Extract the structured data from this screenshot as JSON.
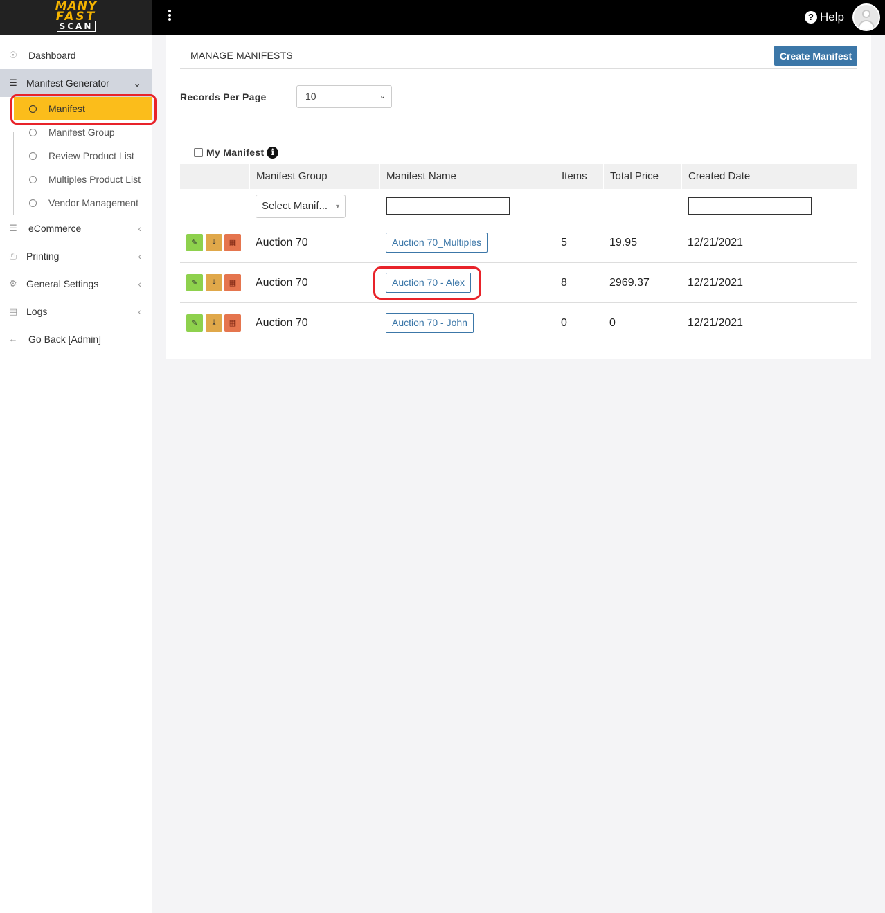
{
  "app": {
    "logo": {
      "line1": "MANY",
      "line2": "FAST",
      "line3": "SCAN"
    },
    "help_label": "Help"
  },
  "sidebar": {
    "items": [
      {
        "label": "Dashboard",
        "icon": "compass-icon"
      },
      {
        "label": "Manifest Generator",
        "icon": "list-icon",
        "expanded": true
      },
      {
        "label": "eCommerce",
        "icon": "list-icon"
      },
      {
        "label": "Printing",
        "icon": "printer-icon"
      },
      {
        "label": "General Settings",
        "icon": "gears-icon"
      },
      {
        "label": "Logs",
        "icon": "archive-icon"
      },
      {
        "label": "Go Back [Admin]",
        "icon": "arrow-left-icon"
      }
    ],
    "sub_items": [
      {
        "label": "Manifest",
        "active": true
      },
      {
        "label": "Manifest Group"
      },
      {
        "label": "Review Product List"
      },
      {
        "label": "Multiples Product List"
      },
      {
        "label": "Vendor Management"
      }
    ]
  },
  "main": {
    "title": "MANAGE MANIFESTS",
    "create_button": "Create Manifest",
    "records_per_page_label": "Records Per Page",
    "records_per_page_value": "10",
    "my_manifest_label": "My Manifest",
    "table": {
      "columns": [
        "Manifest Group",
        "Manifest Name",
        "Items",
        "Total Price",
        "Created Date"
      ],
      "group_filter_placeholder": "Select Manif...",
      "rows": [
        {
          "group": "Auction 70",
          "name": "Auction 70_Multiples",
          "items": "5",
          "total_price": "19.95",
          "created": "12/21/2021"
        },
        {
          "group": "Auction 70",
          "name": "Auction 70 - Alex",
          "items": "8",
          "total_price": "2969.37",
          "created": "12/21/2021"
        },
        {
          "group": "Auction 70",
          "name": "Auction 70 - John",
          "items": "0",
          "total_price": "0",
          "created": "12/21/2021"
        }
      ]
    }
  },
  "colors": {
    "topbar": "#000000",
    "accent_blue": "#3c77a8",
    "active_sub_item": "#fbbd1b",
    "highlight_red": "#e8232a",
    "edit_green": "#8ed14d",
    "download_orange": "#e0a84a",
    "delete_red": "#e5754e"
  }
}
